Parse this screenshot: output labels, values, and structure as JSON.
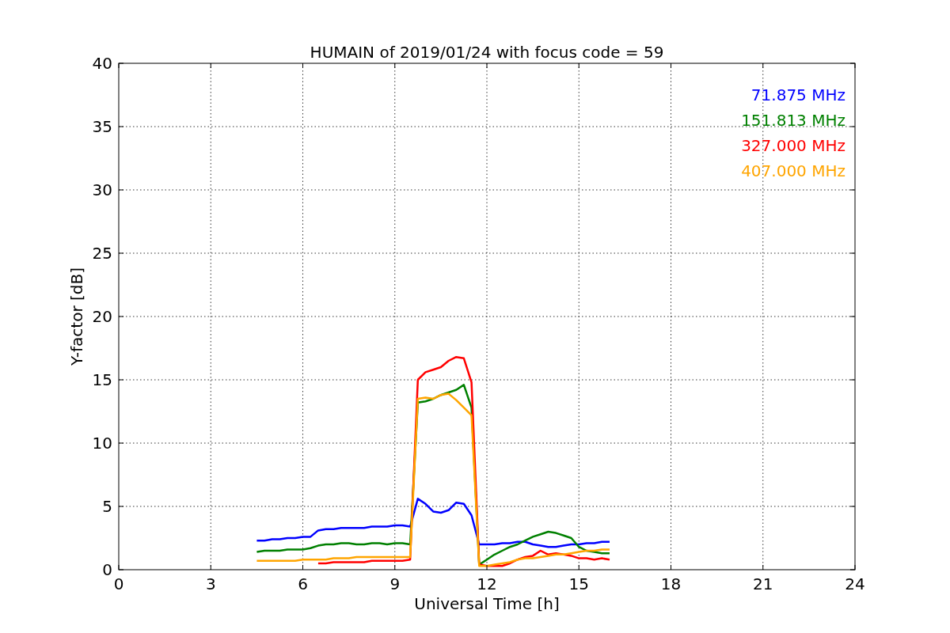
{
  "chart_data": {
    "type": "line",
    "grid": true,
    "title": "HUMAIN of 2019/01/24 with focus code = 59",
    "xlabel": "Universal Time [h]",
    "ylabel": "Y-factor [dB]",
    "xlim": [
      0,
      24
    ],
    "ylim": [
      0,
      40
    ],
    "xticks": [
      0,
      3,
      6,
      9,
      12,
      15,
      18,
      21,
      24
    ],
    "yticks": [
      0,
      5,
      10,
      15,
      20,
      25,
      30,
      35,
      40
    ],
    "x": [
      4.5,
      4.75,
      5,
      5.25,
      5.5,
      5.75,
      6,
      6.25,
      6.5,
      6.75,
      7,
      7.25,
      7.5,
      7.75,
      8,
      8.25,
      8.5,
      8.75,
      9,
      9.25,
      9.5,
      9.75,
      10,
      10.25,
      10.5,
      10.75,
      11,
      11.25,
      11.5,
      11.75,
      12,
      12.25,
      12.5,
      12.75,
      13,
      13.25,
      13.5,
      13.75,
      14,
      14.25,
      14.5,
      14.75,
      15,
      15.25,
      15.5,
      15.75,
      16
    ],
    "series": [
      {
        "name": "71.875 MHz",
        "color": "#0000ff",
        "values": [
          2.3,
          2.3,
          2.4,
          2.4,
          2.5,
          2.5,
          2.6,
          2.6,
          3.1,
          3.2,
          3.2,
          3.3,
          3.3,
          3.3,
          3.3,
          3.4,
          3.4,
          3.4,
          3.5,
          3.5,
          3.4,
          5.6,
          5.2,
          4.6,
          4.5,
          4.7,
          5.3,
          5.2,
          4.3,
          2.0,
          2.0,
          2.0,
          2.1,
          2.1,
          2.2,
          2.2,
          2.0,
          1.9,
          1.8,
          1.8,
          1.9,
          2.0,
          2.0,
          2.1,
          2.1,
          2.2,
          2.2
        ]
      },
      {
        "name": "151.813 MHz",
        "color": "#008000",
        "values": [
          1.4,
          1.5,
          1.5,
          1.5,
          1.6,
          1.6,
          1.6,
          1.7,
          1.9,
          2.0,
          2.0,
          2.1,
          2.1,
          2.0,
          2.0,
          2.1,
          2.1,
          2.0,
          2.1,
          2.1,
          2.0,
          13.2,
          13.3,
          13.5,
          13.8,
          14.0,
          14.2,
          14.6,
          12.8,
          0.4,
          0.8,
          1.2,
          1.5,
          1.8,
          2.0,
          2.3,
          2.6,
          2.8,
          3.0,
          2.9,
          2.7,
          2.5,
          1.8,
          1.5,
          1.4,
          1.3,
          1.3
        ]
      },
      {
        "name": "327.000 MHz",
        "color": "#ff0000",
        "values": [
          null,
          null,
          null,
          null,
          null,
          null,
          null,
          null,
          0.5,
          0.5,
          0.6,
          0.6,
          0.6,
          0.6,
          0.6,
          0.7,
          0.7,
          0.7,
          0.7,
          0.7,
          0.8,
          15.0,
          15.6,
          15.8,
          16.0,
          16.5,
          16.8,
          16.7,
          14.8,
          0.4,
          0.3,
          0.3,
          0.3,
          0.5,
          0.8,
          1.0,
          1.1,
          1.5,
          1.2,
          1.3,
          1.2,
          1.1,
          0.9,
          0.9,
          0.8,
          0.9,
          0.8
        ]
      },
      {
        "name": "407.000 MHz",
        "color": "#ffa500",
        "values": [
          0.7,
          0.7,
          0.7,
          0.7,
          0.7,
          0.7,
          0.8,
          0.8,
          0.8,
          0.8,
          0.9,
          0.9,
          0.9,
          1.0,
          1.0,
          1.0,
          1.0,
          1.0,
          1.0,
          1.0,
          1.0,
          13.5,
          13.6,
          13.5,
          13.8,
          13.9,
          13.4,
          12.8,
          12.2,
          0.3,
          0.3,
          0.4,
          0.5,
          0.6,
          0.8,
          0.9,
          0.9,
          1.0,
          1.1,
          1.2,
          1.2,
          1.3,
          1.4,
          1.5,
          1.5,
          1.6,
          1.6
        ]
      }
    ]
  }
}
